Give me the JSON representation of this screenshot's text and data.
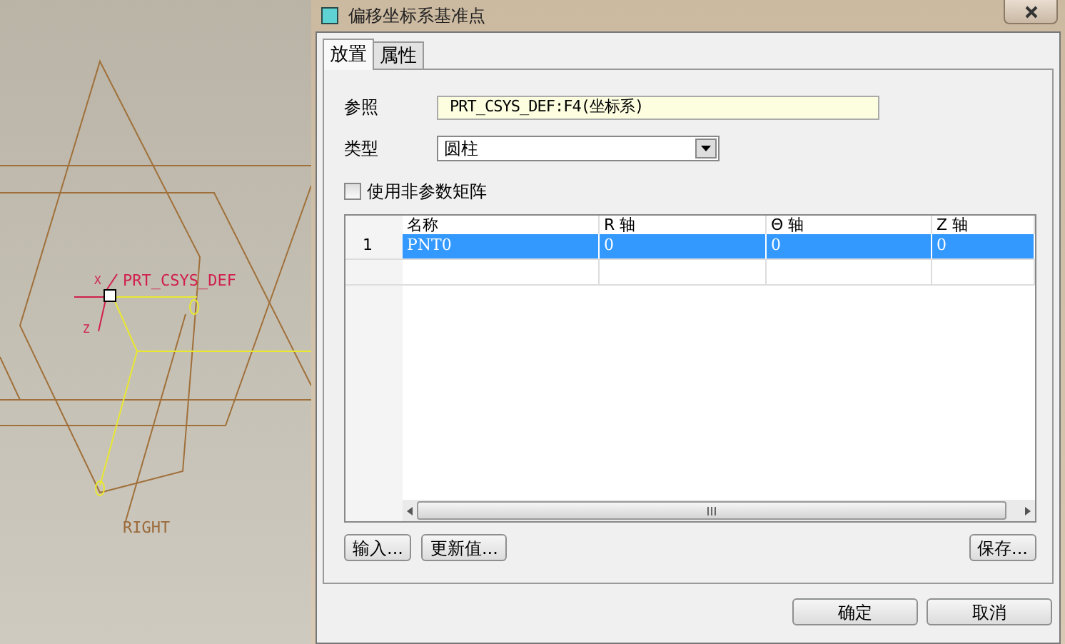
{
  "viewport": {
    "labels": [
      {
        "kind": "axis-x",
        "text": "X"
      },
      {
        "kind": "csys",
        "text": "PRT_CSYS_DEF"
      },
      {
        "kind": "axis-z",
        "text": "Z"
      },
      {
        "kind": "plane",
        "text": "RIGHT"
      }
    ]
  },
  "window": {
    "title": "偏移坐标系基准点"
  },
  "tabs": [
    {
      "label": "放置",
      "selected": true
    },
    {
      "label": "属性",
      "selected": false
    }
  ],
  "reference": {
    "label": "参照",
    "value": "PRT_CSYS_DEF:F4(坐标系)"
  },
  "type": {
    "label": "类型",
    "value": "圆柱"
  },
  "nonparametric": {
    "label": "使用非参数矩阵",
    "checked": false
  },
  "table": {
    "columns": [
      "名称",
      "R 轴",
      "Θ 轴",
      "Z 轴"
    ],
    "rows": [
      {
        "index": "1",
        "cells": [
          "PNT0",
          "0",
          "0",
          "0"
        ],
        "selected": true
      }
    ]
  },
  "actions": [
    "输入...",
    "更新值..."
  ],
  "save": "保存...",
  "buttons": [
    "确定",
    "取消"
  ]
}
